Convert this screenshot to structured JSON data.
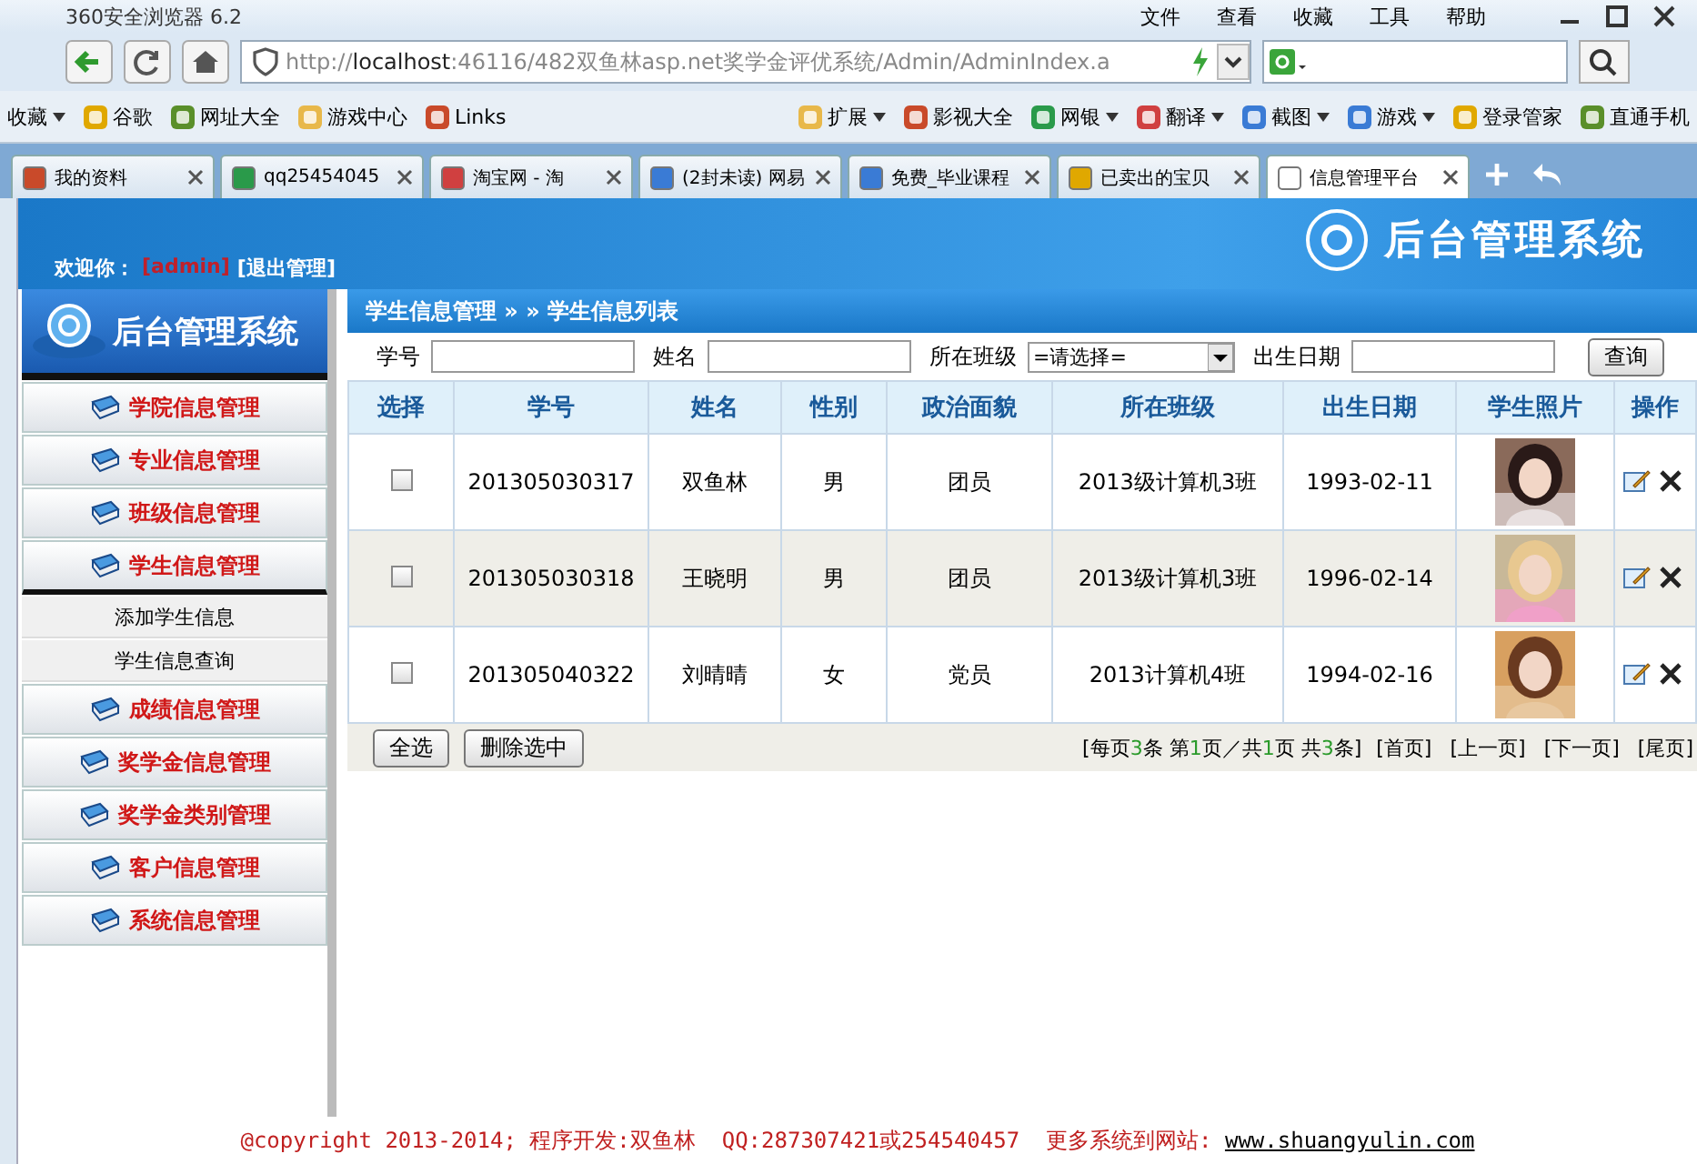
{
  "browser": {
    "title": "360安全浏览器 6.2",
    "menus": [
      "文件",
      "查看",
      "收藏",
      "工具",
      "帮助"
    ],
    "url": {
      "scheme": "http://",
      "host": "localhost",
      "path": ":46116/482双鱼林asp.net奖学金评优系统/Admin/AdminIndex.a"
    },
    "bookmarks": [
      {
        "label": "收藏",
        "dropdown": true
      },
      {
        "label": "谷歌",
        "dropdown": false
      },
      {
        "label": "网址大全",
        "dropdown": false
      },
      {
        "label": "游戏中心",
        "dropdown": false
      },
      {
        "label": "Links",
        "dropdown": false
      }
    ],
    "tools": [
      {
        "label": "扩展",
        "dropdown": true
      },
      {
        "label": "影视大全",
        "dropdown": false
      },
      {
        "label": "网银",
        "dropdown": true
      },
      {
        "label": "翻译",
        "dropdown": true
      },
      {
        "label": "截图",
        "dropdown": true
      },
      {
        "label": "游戏",
        "dropdown": true
      },
      {
        "label": "登录管家",
        "dropdown": false
      },
      {
        "label": "直通手机",
        "dropdown": false
      }
    ],
    "tabs": [
      {
        "label": "我的资料",
        "selected": false
      },
      {
        "label": "qq25454045",
        "selected": false
      },
      {
        "label": "淘宝网 - 淘",
        "selected": false
      },
      {
        "label": "(2封未读) 网易",
        "selected": false
      },
      {
        "label": "免费_毕业课程",
        "selected": false
      },
      {
        "label": "已卖出的宝贝",
        "selected": false
      },
      {
        "label": "信息管理平台",
        "selected": true
      }
    ]
  },
  "header": {
    "welcome": "欢迎你：",
    "user": "[admin]",
    "logout": "[退出管理]",
    "title": "后台管理系统"
  },
  "sidebar": {
    "logo": "后台管理系统",
    "items": [
      {
        "label": "学院信息管理",
        "expanded": false
      },
      {
        "label": "专业信息管理",
        "expanded": false
      },
      {
        "label": "班级信息管理",
        "expanded": false
      },
      {
        "label": "学生信息管理",
        "expanded": true,
        "children": [
          {
            "label": "添加学生信息"
          },
          {
            "label": "学生信息查询"
          }
        ]
      },
      {
        "label": "成绩信息管理",
        "expanded": false
      },
      {
        "label": "奖学金信息管理",
        "expanded": false
      },
      {
        "label": "奖学金类别管理",
        "expanded": false
      },
      {
        "label": "客户信息管理",
        "expanded": false
      },
      {
        "label": "系统信息管理",
        "expanded": false
      }
    ]
  },
  "breadcrumb": "学生信息管理 » » 学生信息列表",
  "search": {
    "fields": [
      {
        "label": "学号",
        "kind": "text"
      },
      {
        "label": "姓名",
        "kind": "text"
      },
      {
        "label": "所在班级",
        "kind": "select",
        "value": "=请选择="
      },
      {
        "label": "出生日期",
        "kind": "text"
      }
    ],
    "button": "查询"
  },
  "table": {
    "columns": [
      "选择",
      "学号",
      "姓名",
      "性别",
      "政治面貌",
      "所在班级",
      "出生日期",
      "学生照片",
      "操作"
    ],
    "rows": [
      {
        "checked": false,
        "highlighted": false,
        "cells": [
          "",
          "201305030317",
          "双鱼林",
          "男",
          "团员",
          "2013级计算机3班",
          "1993-02-11"
        ]
      },
      {
        "checked": false,
        "highlighted": true,
        "cells": [
          "",
          "201305030318",
          "王晓明",
          "男",
          "团员",
          "2013级计算机3班",
          "1996-02-14"
        ]
      },
      {
        "checked": false,
        "highlighted": false,
        "cells": [
          "",
          "201305040322",
          "刘晴晴",
          "女",
          "党员",
          "2013计算机4班",
          "1994-02-16"
        ]
      }
    ]
  },
  "actions": [
    "全选",
    "删除选中"
  ],
  "pager": {
    "info": [
      {
        "text": "[每页",
        "number": false
      },
      {
        "text": "3",
        "number": true
      },
      {
        "text": "条 第",
        "number": false
      },
      {
        "text": "1",
        "number": true
      },
      {
        "text": "页／共",
        "number": false
      },
      {
        "text": "1",
        "number": true
      },
      {
        "text": "页 共",
        "number": false
      },
      {
        "text": "3",
        "number": true
      },
      {
        "text": "条]",
        "number": false
      }
    ],
    "links": [
      "[首页]",
      "[上一页]",
      "[下一页]",
      "[尾页]"
    ]
  },
  "footer": {
    "text": "@copyright 2013-2014; 程序开发:双鱼林  QQ:287307421或254540457  更多系统到网站: ",
    "link": "www.shuangyulin.com"
  }
}
